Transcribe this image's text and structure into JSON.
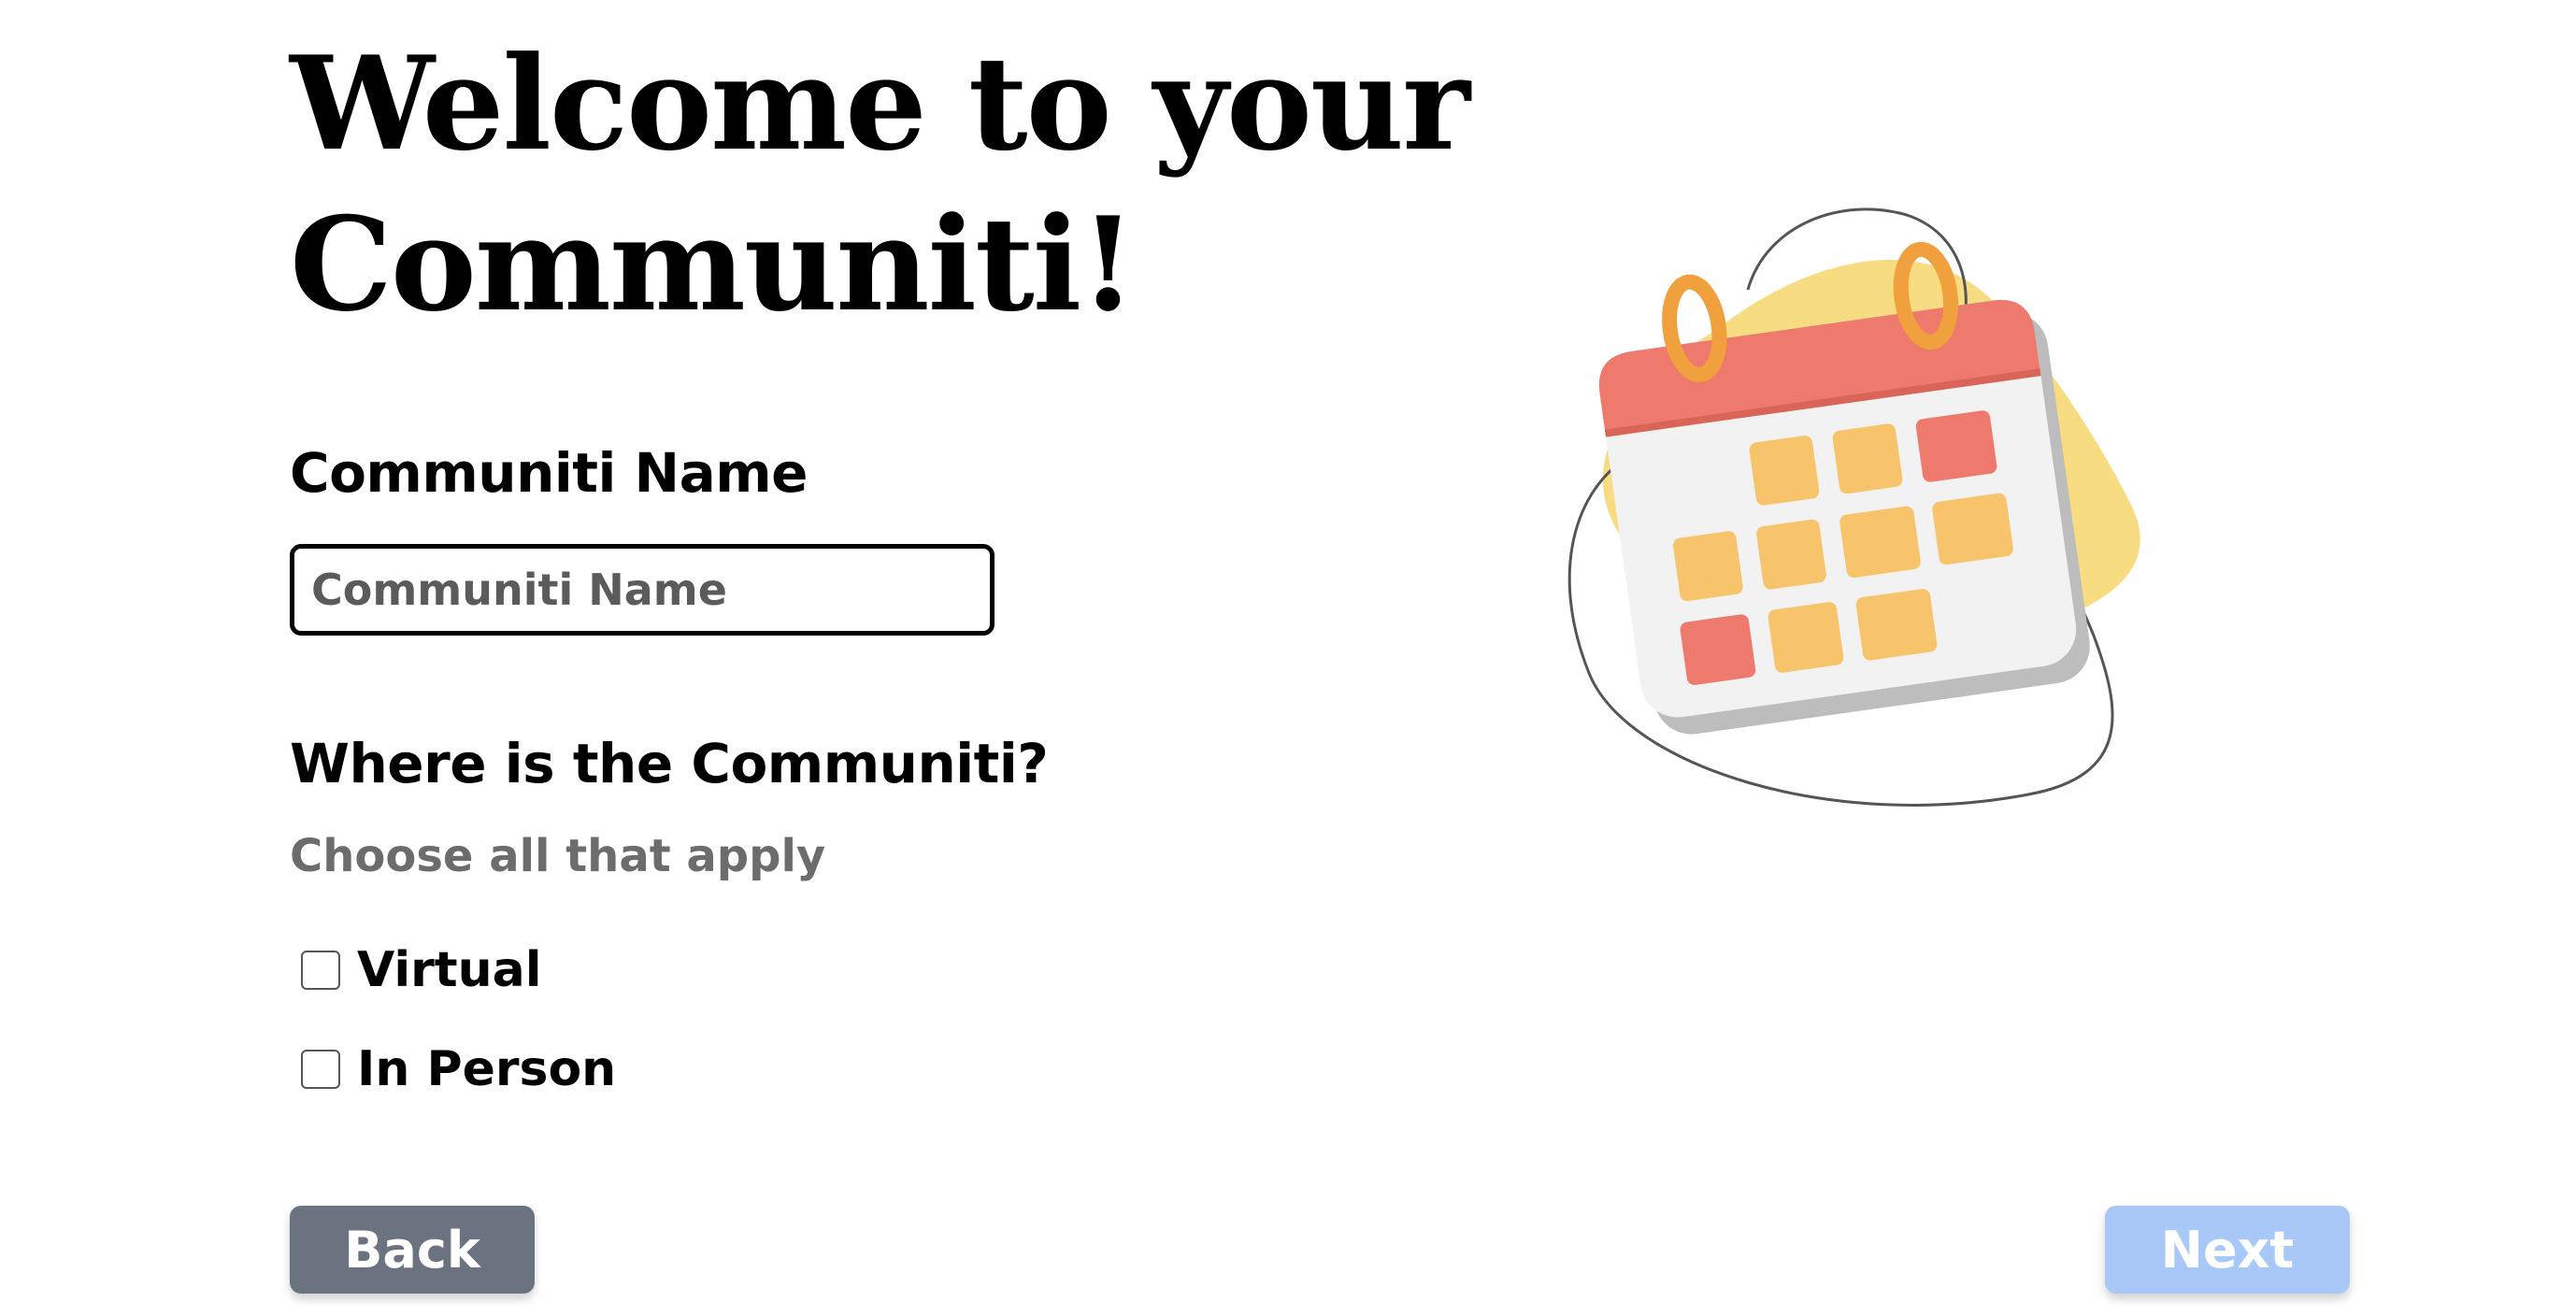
{
  "title_line1": "Welcome to your",
  "title_line2": "Communiti!",
  "name_section": {
    "label": "Communiti Name",
    "placeholder": "Communiti Name",
    "value": ""
  },
  "location_section": {
    "label": "Where is the Communiti?",
    "hint": "Choose all that apply",
    "options": [
      {
        "label": "Virtual",
        "checked": false
      },
      {
        "label": "In Person",
        "checked": false
      }
    ]
  },
  "buttons": {
    "back_label": "Back",
    "next_label": "Next"
  },
  "colors": {
    "back_button": "#6b7280",
    "next_button_disabled": "#a8c8f8",
    "blob_yellow": "#f8dc82",
    "calendar_header": "#ee7a6d",
    "calendar_cell_orange": "#f7c46c",
    "calendar_cell_red": "#ee7a6d"
  },
  "illustration": {
    "icon": "calendar-icon"
  }
}
